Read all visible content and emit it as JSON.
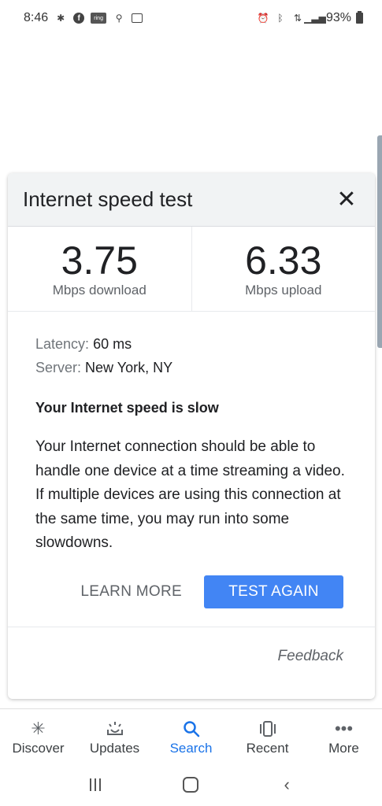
{
  "status_bar": {
    "time": "8:46",
    "battery": "93%",
    "ring_label": "ring"
  },
  "card": {
    "title": "Internet speed test",
    "download": {
      "value": "3.75",
      "unit": "Mbps download"
    },
    "upload": {
      "value": "6.33",
      "unit": "Mbps upload"
    },
    "latency_label": "Latency:",
    "latency_value": "60 ms",
    "server_label": "Server:",
    "server_value": "New York, NY",
    "verdict": "Your Internet speed is slow",
    "description": "Your Internet connection should be able to handle one device at a time streaming a video. If multiple devices are using this connection at the same time, you may run into some slowdowns.",
    "learn_more": "LEARN MORE",
    "test_again": "TEST AGAIN",
    "feedback": "Feedback"
  },
  "bottom_nav": {
    "items": [
      {
        "label": "Discover",
        "icon": "asterisk-icon"
      },
      {
        "label": "Updates",
        "icon": "updates-icon"
      },
      {
        "label": "Search",
        "icon": "search-icon",
        "active": true
      },
      {
        "label": "Recent",
        "icon": "recent-icon"
      },
      {
        "label": "More",
        "icon": "more-icon"
      }
    ]
  },
  "colors": {
    "accent": "#4285f4",
    "active_nav": "#1a73e8",
    "header_bg": "#f1f3f4"
  }
}
